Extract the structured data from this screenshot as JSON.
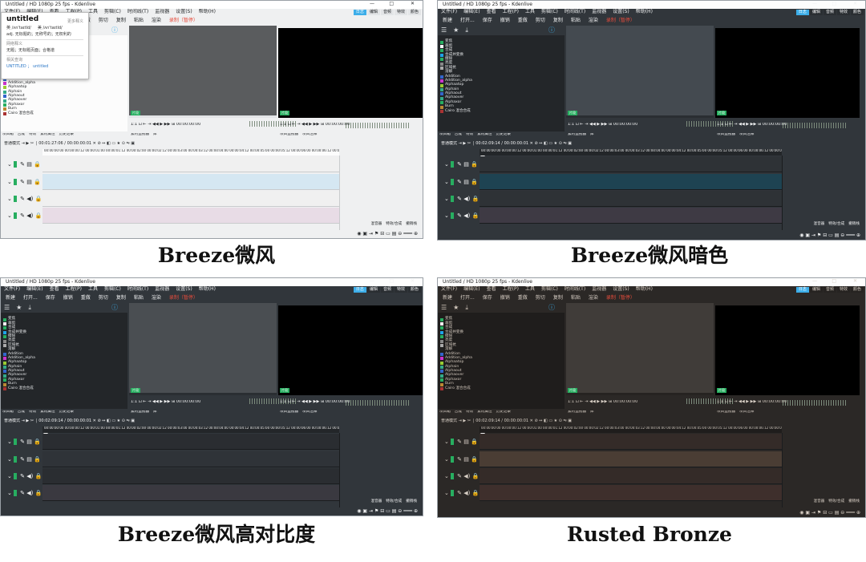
{
  "window": {
    "title": "Untitled / HD 1080p 25 fps - Kdenlive",
    "min_icon": "minimize-icon",
    "max_icon": "maximize-icon",
    "close_icon": "close-icon"
  },
  "menu": [
    "文件(F)",
    "编辑(E)",
    "查看",
    "工程(P)",
    "工具",
    "剪辑(C)",
    "时间线(T)",
    "监视器",
    "设置(S)",
    "帮助(H)"
  ],
  "workspaces": [
    "日志",
    "编辑",
    "音频",
    "特效",
    "颜色"
  ],
  "toolbar": {
    "new": "新建",
    "open": "打开...",
    "save": "保存",
    "undo": "撤销",
    "redo": "重做",
    "cut": "剪切",
    "copy": "复制",
    "paste": "粘贴",
    "render": "渲染",
    "record": "录制（暂停）"
  },
  "bin_items": [
    {
      "label": "变焦",
      "color": "#27ae60"
    },
    {
      "label": "裁剪",
      "color": "#ffffff"
    },
    {
      "label": "合成",
      "color": "#27ae60"
    },
    {
      "label": "合成并变换",
      "color": "#1fa3e8"
    },
    {
      "label": "擦除",
      "color": "#27ae60"
    },
    {
      "label": "亮度",
      "color": "#888888"
    },
    {
      "label": "区域抗",
      "color": "#aaaaaa"
    },
    {
      "label": "溶解",
      "color": "#222222"
    },
    {
      "label": "Addition",
      "color": "#3366cc"
    },
    {
      "label": "Addition_alpha",
      "color": "#cc33cc"
    },
    {
      "label": "Alphaatop",
      "color": "#99cc33"
    },
    {
      "label": "Alphain",
      "color": "#33aa88"
    },
    {
      "label": "Alphaout",
      "color": "#3366cc"
    },
    {
      "label": "Alphaover",
      "color": "#33aa88"
    },
    {
      "label": "Alphaxor",
      "color": "#27ae60"
    },
    {
      "label": "Burn",
      "color": "#bb8833"
    },
    {
      "label": "Cairo 混合合成",
      "color": "#aa3333"
    }
  ],
  "monitor": {
    "zoom": "1:1",
    "clip_timecode": "00:00:00:00",
    "proj_timecode": "00:00:00:00",
    "clip_label": "片段",
    "proj_label": "片段"
  },
  "tabs_left": [
    "项目箱",
    "合成",
    "特效",
    "素材属性",
    "历史记录"
  ],
  "tabs_mid": [
    "素材监视器",
    "库"
  ],
  "tabs_right": [
    "项目监视器",
    "项目注释"
  ],
  "timeline": {
    "mode": "普通模式",
    "timecode": "00:02:09:14 / 00:00:00:01",
    "timecode_a": "00:01:27:06 / 00:00:00:01",
    "ruler_marks": "00:00:00:00  00:00:00:12  00:00:01:00  00:00:01:12  00:00:02:00  00:00:02:12  00:00:03:00  00:00:03:12  00:00:04:00  00:00:04:12  00:00:05:00  00:00:05:12  00:00:06:00  00:00:06:12  00:00:07:00"
  },
  "right_tabs": [
    "混音器",
    "特效/合成",
    "撤销栈"
  ],
  "popup": {
    "title": "untitled",
    "more": "更多释义",
    "line1": "英 /ʌn'taɪtld/",
    "line1b": "美 /ʌn'taɪtld/",
    "line2": "adj. 无标题的；无称号的；无权利的",
    "sec1": "网络释义",
    "sec1_text": "无题；无标题页面；合格谱",
    "sec2": "相关查询",
    "sec2_text": "UNTITLED ； untitled"
  },
  "captions": [
    "Breeze微风",
    "Breeze微风暗色",
    "Breeze微风高对比度",
    "Rusted Bronze"
  ],
  "themes": [
    {
      "bg": "#eff0f1",
      "panel": "#fcfcfc",
      "text": "#232629",
      "monitor": "#5a5c5e",
      "track_a": "#d5e7f2",
      "track_b": "#e8dce6",
      "track_base": "#f0f0f0",
      "bar": "#e3e5e7",
      "bin_text": "#232629"
    },
    {
      "bg": "#31363b",
      "panel": "#232629",
      "text": "#eff0f1",
      "monitor": "#444a50",
      "track_a": "#1e4352",
      "track_b": "#3e3a44",
      "track_base": "#2e3236",
      "bar": "#2a2e32",
      "bin_text": "#dfe1e3"
    },
    {
      "bg": "#31363b",
      "panel": "#232629",
      "text": "#eff0f1",
      "monitor": "#4a4e52",
      "track_a": "#2f3338",
      "track_b": "#3a3940",
      "track_base": "#2a2d31",
      "bar": "#2a2e32",
      "bin_text": "#dfe1e3"
    },
    {
      "bg": "#2b2826",
      "panel": "#1f1d1c",
      "text": "#d8cfc5",
      "monitor": "#403c39",
      "track_a": "#4a3d34",
      "track_b": "#3e2f2c",
      "track_base": "#342b28",
      "bar": "#262321",
      "bin_text": "#d0c6bb"
    }
  ]
}
